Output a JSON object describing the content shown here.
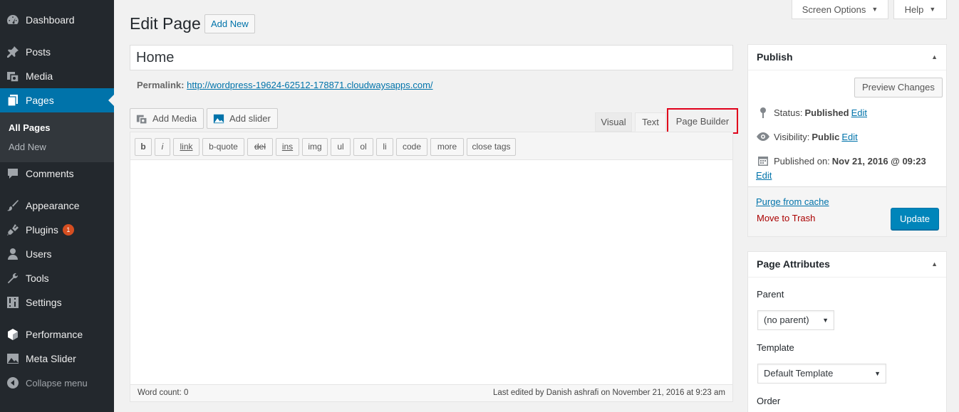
{
  "sidebar": {
    "items": [
      {
        "label": "Dashboard",
        "icon": "dashboard-icon"
      },
      {
        "label": "Posts",
        "icon": "pin-icon"
      },
      {
        "label": "Media",
        "icon": "media-icon"
      },
      {
        "label": "Pages",
        "icon": "pages-icon"
      },
      {
        "label": "Comments",
        "icon": "comment-icon"
      },
      {
        "label": "Appearance",
        "icon": "brush-icon"
      },
      {
        "label": "Plugins",
        "icon": "plugin-icon",
        "badge": "1"
      },
      {
        "label": "Users",
        "icon": "users-icon"
      },
      {
        "label": "Tools",
        "icon": "wrench-icon"
      },
      {
        "label": "Settings",
        "icon": "settings-icon"
      },
      {
        "label": "Performance",
        "icon": "performance-icon"
      },
      {
        "label": "Meta Slider",
        "icon": "metaslider-icon"
      }
    ],
    "submenu": [
      "All Pages",
      "Add New"
    ],
    "collapse": "Collapse menu"
  },
  "header": {
    "title": "Edit Page",
    "add_new": "Add New",
    "screen_options": "Screen Options",
    "help": "Help"
  },
  "post": {
    "title": "Home",
    "permalink_label": "Permalink:",
    "permalink_url": "http://wordpress-19624-62512-178871.cloudwaysapps.com/"
  },
  "media_buttons": {
    "add_media": "Add Media",
    "add_slider": "Add slider"
  },
  "editor_tabs": {
    "visual": "Visual",
    "text": "Text",
    "page_builder": "Page Builder"
  },
  "quicktags": [
    "b",
    "i",
    "link",
    "b-quote",
    "del",
    "ins",
    "img",
    "ul",
    "ol",
    "li",
    "code",
    "more",
    "close tags"
  ],
  "status": {
    "word_count": "Word count: 0",
    "last_edited": "Last edited by Danish ashrafi on November 21, 2016 at 9:23 am"
  },
  "publish": {
    "title": "Publish",
    "preview": "Preview Changes",
    "status_label": "Status:",
    "status_value": "Published",
    "visibility_label": "Visibility:",
    "visibility_value": "Public",
    "published_label": "Published on:",
    "published_value": "Nov 21, 2016 @ 09:23",
    "edit": "Edit",
    "purge": "Purge from cache",
    "trash": "Move to Trash",
    "update": "Update"
  },
  "attributes": {
    "title": "Page Attributes",
    "parent_label": "Parent",
    "parent_value": "(no parent)",
    "template_label": "Template",
    "template_value": "Default Template",
    "order_label": "Order"
  },
  "colors": {
    "accent": "#0073aa",
    "sidebar": "#23282d",
    "highlight": "#e0001b",
    "trash": "#a00"
  }
}
